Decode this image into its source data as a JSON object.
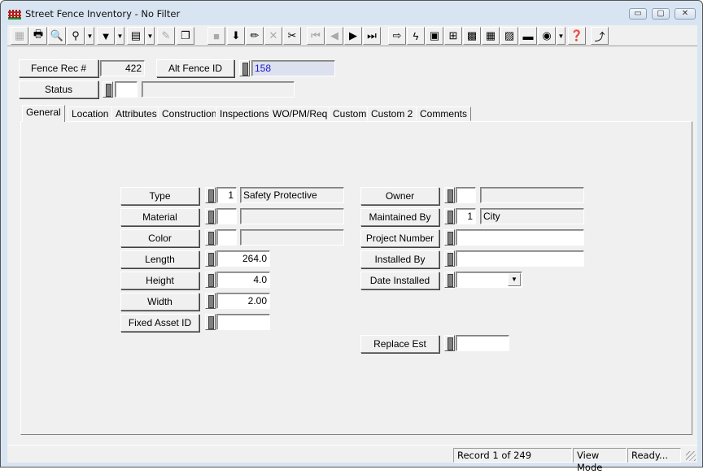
{
  "window": {
    "title": "Street Fence Inventory - No Filter",
    "icon": "fence-icon",
    "controls": {
      "minimize": "▭",
      "maximize": "▢",
      "close": "✕"
    }
  },
  "toolbar": {
    "buttons": [
      {
        "name": "blank-form-icon",
        "glyph": "▦",
        "disabled": true
      },
      {
        "name": "print-icon",
        "glyph": "🖶"
      },
      {
        "name": "print-preview-icon",
        "glyph": "🔍"
      },
      {
        "name": "find-binoculars-icon",
        "glyph": "⚲",
        "dropdown": true
      },
      {
        "name": "filter-funnel-icon",
        "glyph": "▼",
        "dropdown": true
      },
      {
        "name": "report-icon",
        "glyph": "▤",
        "dropdown": true
      },
      {
        "name": "edit-document-icon",
        "glyph": "✎",
        "disabled": true
      },
      {
        "name": "copy-record-icon",
        "glyph": "❐"
      },
      {
        "name": "save-icon",
        "glyph": "■",
        "disabled": true
      },
      {
        "name": "import-icon",
        "glyph": "⬇"
      },
      {
        "name": "pencil-edit-icon",
        "glyph": "✏"
      },
      {
        "name": "delete-icon",
        "glyph": "✕",
        "disabled": true
      },
      {
        "name": "cut-scissors-icon",
        "glyph": "✂"
      },
      {
        "name": "first-record-icon",
        "glyph": "⏮",
        "disabled": true
      },
      {
        "name": "previous-record-icon",
        "glyph": "◀",
        "disabled": true
      },
      {
        "name": "next-record-icon",
        "glyph": "▶"
      },
      {
        "name": "last-record-icon",
        "glyph": "⏭"
      },
      {
        "name": "goto-arrow-icon",
        "glyph": "⇨"
      },
      {
        "name": "lightning-icon",
        "glyph": "ϟ"
      },
      {
        "name": "map-layers-icon",
        "glyph": "▣"
      },
      {
        "name": "hierarchy-icon",
        "glyph": "⊞"
      },
      {
        "name": "equipment-icon",
        "glyph": "▩"
      },
      {
        "name": "calculator-icon",
        "glyph": "▦"
      },
      {
        "name": "building-map-icon",
        "glyph": "▨"
      },
      {
        "name": "toolbox-icon",
        "glyph": "▬"
      },
      {
        "name": "globe-search-icon",
        "glyph": "◉",
        "dropdown": true
      },
      {
        "name": "help-book-icon",
        "glyph": "❓"
      },
      {
        "name": "exit-icon",
        "glyph": "⤴"
      }
    ]
  },
  "header": {
    "fence_rec_label": "Fence Rec #",
    "fence_rec_value": "422",
    "alt_id_label": "Alt Fence ID",
    "alt_id_value": "158",
    "status_label": "Status",
    "status_code": "",
    "status_desc": ""
  },
  "tabs": [
    {
      "label": "General",
      "active": true
    },
    {
      "label": "Location"
    },
    {
      "label": "Attributes"
    },
    {
      "label": "Construction"
    },
    {
      "label": "Inspections"
    },
    {
      "label": "WO/PM/Req"
    },
    {
      "label": "Custom"
    },
    {
      "label": "Custom 2"
    },
    {
      "label": "Comments"
    }
  ],
  "general": {
    "left": {
      "type": {
        "label": "Type",
        "code": "1",
        "desc": "Safety Protective"
      },
      "material": {
        "label": "Material",
        "code": "",
        "desc": ""
      },
      "color": {
        "label": "Color",
        "code": "",
        "desc": ""
      },
      "length": {
        "label": "Length",
        "value": "264.0"
      },
      "height": {
        "label": "Height",
        "value": "4.0"
      },
      "width": {
        "label": "Width",
        "value": "2.00"
      },
      "fixed_asset_id": {
        "label": "Fixed Asset ID",
        "value": ""
      }
    },
    "right": {
      "owner": {
        "label": "Owner",
        "code": "",
        "desc": ""
      },
      "maintained_by": {
        "label": "Maintained By",
        "code": "1",
        "desc": "City"
      },
      "project_number": {
        "label": "Project Number",
        "value": ""
      },
      "installed_by": {
        "label": "Installed By",
        "value": ""
      },
      "date_installed": {
        "label": "Date Installed",
        "value": " /  /",
        "arrow": "▼"
      },
      "replace_est": {
        "label": "Replace Est",
        "value": ""
      }
    }
  },
  "statusbar": {
    "record": "Record 1 of 249",
    "mode": "View Mode",
    "state": "Ready..."
  }
}
